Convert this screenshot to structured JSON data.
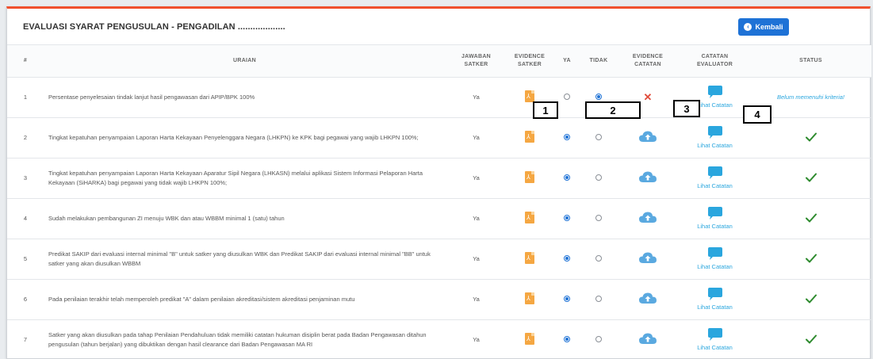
{
  "header": {
    "title": "EVALUASI SYARAT PENGUSULAN - PENGADILAN ...................",
    "back_button": "Kembali"
  },
  "columns": {
    "no": "#",
    "uraian": "URAIAN",
    "jawaban_l1": "JAWABAN",
    "jawaban_l2": "SATKER",
    "evidence_l1": "EVIDENCE",
    "evidence_l2": "SATKER",
    "ya": "YA",
    "tidak": "TIDAK",
    "evcat_l1": "EVIDENCE",
    "evcat_l2": "CATATAN",
    "catatan_l1": "CATATAN",
    "catatan_l2": "EVALUATOR",
    "status": "STATUS"
  },
  "rows": [
    {
      "no": "1",
      "uraian": "Persentase penyelesaian tindak lanjut hasil pengawasan dari APIP/BPK 100%",
      "jawaban": "Ya",
      "ya": false,
      "tidak": true,
      "evidence_catatan": "x",
      "catatan_link": "Lihat Catatan",
      "status": "Belum memenuhi kriteria!",
      "status_ok": false
    },
    {
      "no": "2",
      "uraian": "Tingkat kepatuhan penyampaian Laporan Harta Kekayaan Penyelenggara Negara (LHKPN) ke KPK bagi pegawai yang wajib LHKPN 100%;",
      "jawaban": "Ya",
      "ya": true,
      "tidak": false,
      "evidence_catatan": "upload",
      "catatan_link": "Lihat Catatan",
      "status": "",
      "status_ok": true
    },
    {
      "no": "3",
      "uraian": "Tingkat kepatuhan penyampaian Laporan Harta Kekayaan Aparatur Sipil Negara (LHKASN) melalui aplikasi Sistem Informasi Pelaporan Harta Kekayaan (SiHARKA) bagi pegawai yang tidak wajib LHKPN 100%;",
      "jawaban": "Ya",
      "ya": true,
      "tidak": false,
      "evidence_catatan": "upload",
      "catatan_link": "Lihat Catatan",
      "status": "",
      "status_ok": true
    },
    {
      "no": "4",
      "uraian": "Sudah melakukan pembangunan ZI menuju WBK dan atau WBBM minimal 1 (satu) tahun",
      "jawaban": "Ya",
      "ya": true,
      "tidak": false,
      "evidence_catatan": "upload",
      "catatan_link": "Lihat Catatan",
      "status": "",
      "status_ok": true
    },
    {
      "no": "5",
      "uraian": "Predikat SAKIP dari evaluasi internal minimal \"B\" untuk satker yang diusulkan WBK dan Predikat SAKIP dari evaluasi internal minimal \"BB\" untuk satker yang akan diusulkan WBBM",
      "jawaban": "Ya",
      "ya": true,
      "tidak": false,
      "evidence_catatan": "upload",
      "catatan_link": "Lihat Catatan",
      "status": "",
      "status_ok": true
    },
    {
      "no": "6",
      "uraian": "Pada penilaian terakhir telah memperoleh predikat \"A\" dalam penilaian akreditasi/sistem akreditasi penjaminan mutu",
      "jawaban": "Ya",
      "ya": true,
      "tidak": false,
      "evidence_catatan": "upload",
      "catatan_link": "Lihat Catatan",
      "status": "",
      "status_ok": true
    },
    {
      "no": "7",
      "uraian": "Satker yang akan diusulkan pada tahap Penilaian Pendahuluan tidak memiliki catatan hukuman disiplin berat pada Badan Pengawasan ditahun pengusulan (tahun berjalan) yang dibuktikan dengan hasil clearance dari Badan Pengawasan MA RI",
      "jawaban": "Ya",
      "ya": true,
      "tidak": false,
      "evidence_catatan": "upload",
      "catatan_link": "Lihat Catatan",
      "status": "",
      "status_ok": true
    }
  ],
  "annotations": [
    "1",
    "2",
    "3",
    "4"
  ],
  "colors": {
    "accent": "#1e72d6",
    "link": "#2aa6de",
    "pdf": "#f5a742",
    "check": "#2e8b2e",
    "error": "#e04a3a",
    "top_border": "#f0502e"
  },
  "icons": {
    "pdf": "file-pdf-icon",
    "upload": "cloud-upload-icon",
    "note": "comment-icon",
    "ok": "check-icon",
    "fail": "x-mark-icon",
    "back": "arrow-left-circle-icon"
  }
}
